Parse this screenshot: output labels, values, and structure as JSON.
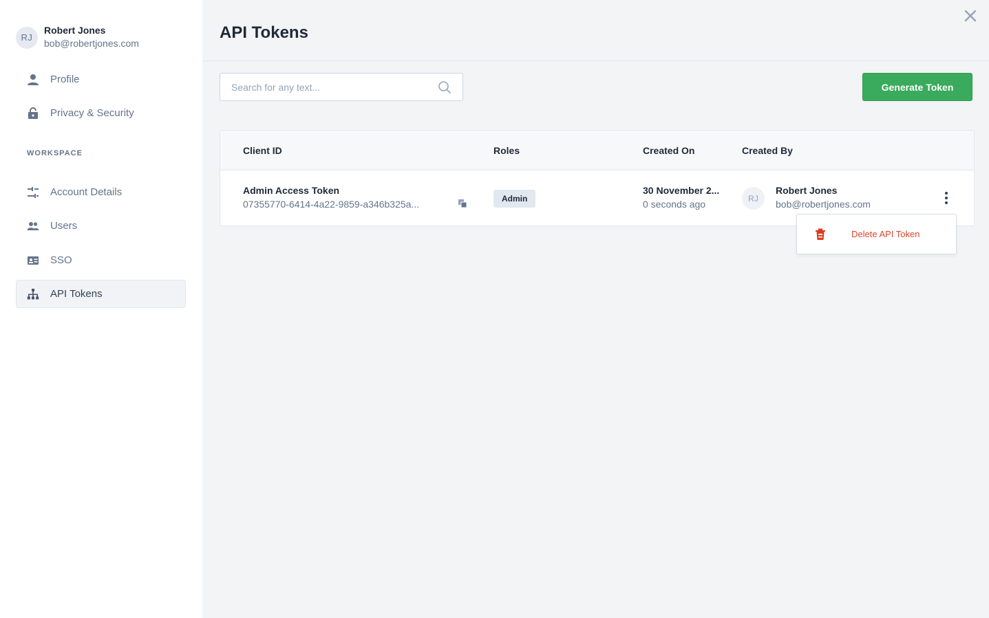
{
  "user": {
    "initials": "RJ",
    "name": "Robert Jones",
    "email": "bob@robertjones.com"
  },
  "sidebar": {
    "items": [
      {
        "label": "Profile",
        "icon": "person-icon"
      },
      {
        "label": "Privacy & Security",
        "icon": "lock-icon"
      }
    ],
    "section_label": "WORKSPACE",
    "workspace_items": [
      {
        "label": "Account Details",
        "icon": "sliders-icon"
      },
      {
        "label": "Users",
        "icon": "users-icon"
      },
      {
        "label": "SSO",
        "icon": "id-card-icon"
      },
      {
        "label": "API Tokens",
        "icon": "network-icon",
        "active": true
      }
    ]
  },
  "page": {
    "title": "API Tokens"
  },
  "search": {
    "placeholder": "Search for any text..."
  },
  "toolbar": {
    "generate_label": "Generate Token"
  },
  "table": {
    "headers": [
      "Client ID",
      "Roles",
      "Created On",
      "Created By"
    ],
    "rows": [
      {
        "token_name": "Admin Access Token",
        "token_id": "07355770-6414-4a22-9859-a346b325a...",
        "role": "Admin",
        "created_on": "30 November 2...",
        "created_ago": "0 seconds ago",
        "creator_initials": "RJ",
        "creator_name": "Robert Jones",
        "creator_email": "bob@robertjones.com"
      }
    ]
  },
  "dropdown": {
    "delete_label": "Delete API Token"
  },
  "colors": {
    "accent_green": "#3aaa5c",
    "danger_red": "#d9452a"
  }
}
